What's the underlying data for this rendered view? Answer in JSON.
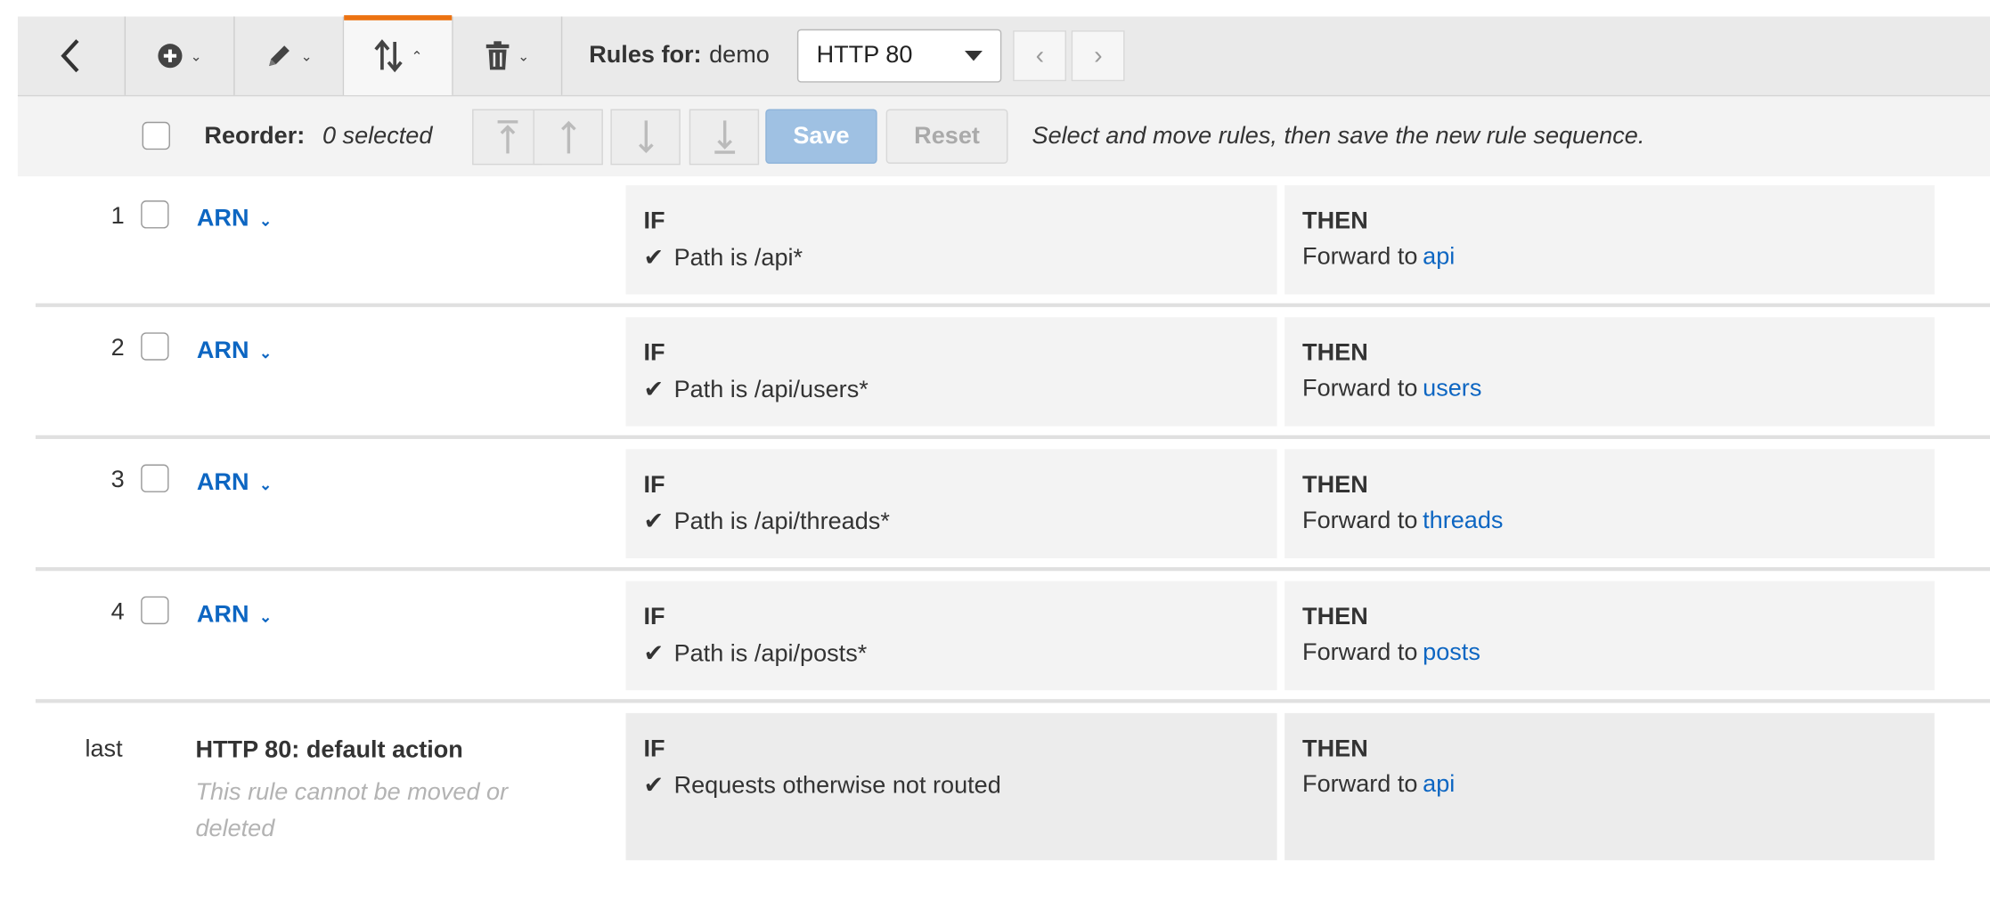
{
  "toolbar": {
    "back_icon": "chevron-left-icon",
    "add_icon": "plus-circle-icon",
    "edit_icon": "pencil-icon",
    "reorder_icon": "reorder-arrows-icon",
    "delete_icon": "trash-icon",
    "rules_for_label": "Rules for:",
    "rules_for_value": "demo",
    "listener_select": "HTTP 80",
    "accent_color": "#ec7211"
  },
  "reorder_bar": {
    "label": "Reorder:",
    "selected_text": "0 selected",
    "save_label": "Save",
    "reset_label": "Reset",
    "hint": "Select and move rules, then save the new rule sequence."
  },
  "rules": [
    {
      "number": "1",
      "name": "ARN",
      "if_label": "IF",
      "condition": "Path is /api*",
      "then_label": "THEN",
      "action": "Forward to",
      "target": "api"
    },
    {
      "number": "2",
      "name": "ARN",
      "if_label": "IF",
      "condition": "Path is /api/users*",
      "then_label": "THEN",
      "action": "Forward to",
      "target": "users"
    },
    {
      "number": "3",
      "name": "ARN",
      "if_label": "IF",
      "condition": "Path is /api/threads*",
      "then_label": "THEN",
      "action": "Forward to",
      "target": "threads"
    },
    {
      "number": "4",
      "name": "ARN",
      "if_label": "IF",
      "condition": "Path is /api/posts*",
      "then_label": "THEN",
      "action": "Forward to",
      "target": "posts"
    }
  ],
  "default_rule": {
    "number": "last",
    "name": "HTTP 80: default action",
    "note": "This rule cannot be moved or deleted",
    "if_label": "IF",
    "condition": "Requests otherwise not routed",
    "then_label": "THEN",
    "action": "Forward to",
    "target": "api"
  },
  "colors": {
    "link": "#0d66c2",
    "save_button": "#9fc1e3"
  }
}
